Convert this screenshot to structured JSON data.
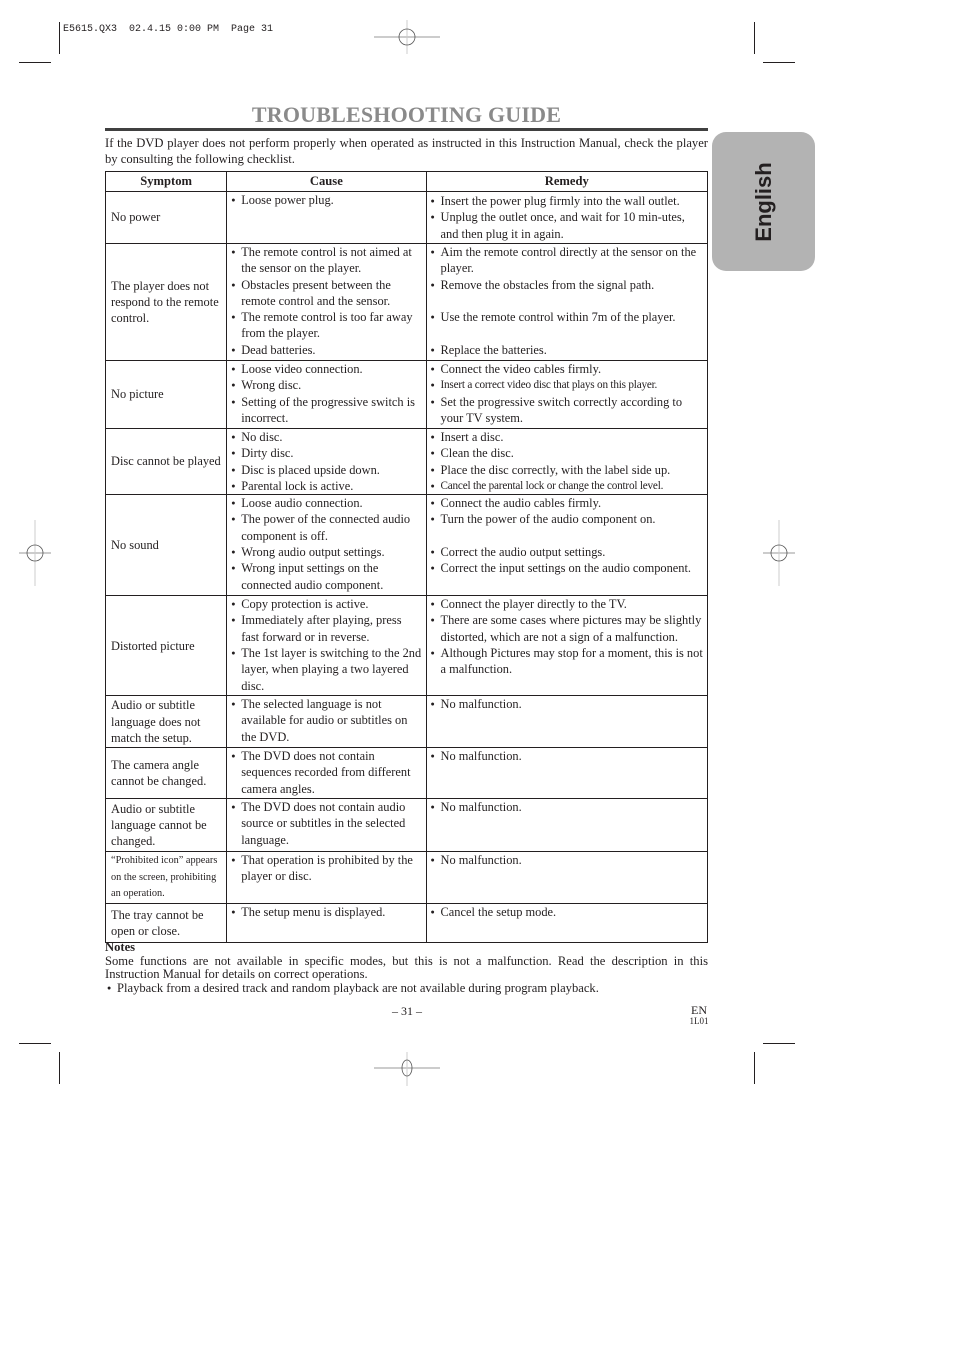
{
  "slug": "E5615.QX3  02.4.15 0:00 PM  Page 31",
  "title": "TROUBLESHOOTING GUIDE",
  "intro": "If the DVD player does not perform properly when operated as instructed in this Instruction Manual, check the player by consulting the following checklist.",
  "side_tab": "English",
  "table": {
    "headers": [
      "Symptom",
      "Cause",
      "Remedy"
    ],
    "rows": [
      {
        "symptom": "No power",
        "causes": [
          "Loose power plug."
        ],
        "remedies": [
          "Insert the power plug firmly into the wall outlet.",
          "Unplug the outlet once, and wait for 10 min-utes, and then plug it in again."
        ]
      },
      {
        "symptom": "The player does not respond to the remote control.",
        "causes": [
          "The remote control is not aimed at the sensor on the player.",
          "Obstacles present between the remote control and the sensor.",
          "The remote control is too far away from the player.",
          "Dead batteries."
        ],
        "remedies": [
          "Aim the remote control directly at the sensor on the player.",
          "Remove the obstacles from the signal path.",
          "Use the remote control within 7m of the player.",
          "Replace the batteries."
        ]
      },
      {
        "symptom": "No picture",
        "causes": [
          "Loose video connection.",
          "Wrong disc.",
          "Setting of the progressive switch is incorrect."
        ],
        "remedies": [
          "Connect the video cables firmly.",
          "Insert a correct video disc that plays on this player.",
          "Set the progressive switch correctly according to your TV system."
        ]
      },
      {
        "symptom": "Disc cannot be played",
        "causes": [
          "No disc.",
          "Dirty disc.",
          "Disc is placed upside down.",
          "Parental lock is active."
        ],
        "remedies": [
          "Insert a disc.",
          "Clean the disc.",
          "Place the disc correctly, with the label side up.",
          "Cancel the parental lock or change the control level."
        ]
      },
      {
        "symptom": "No sound",
        "causes": [
          "Loose audio connection.",
          "The power of the connected audio component is off.",
          "Wrong audio output settings.",
          "Wrong input settings on the connected audio component."
        ],
        "remedies": [
          "Connect the audio cables firmly.",
          "Turn the power of the audio component on.",
          "Correct the audio output settings.",
          "Correct the input settings on the audio component."
        ]
      },
      {
        "symptom": "Distorted picture",
        "causes": [
          "Copy protection is active.",
          "Immediately after playing, press fast forward or in reverse.",
          "The 1st layer is switching to the 2nd layer, when playing a two layered disc."
        ],
        "remedies": [
          "Connect the player directly to the TV.",
          "There are some cases where pictures may be slightly distorted, which are not a sign of a malfunction.",
          "Although Pictures may stop for a moment, this is not a malfunction."
        ]
      },
      {
        "symptom": "Audio or subtitle language does not match the setup.",
        "causes": [
          "The selected language is not available for audio or subtitles on the DVD."
        ],
        "remedies": [
          "No malfunction."
        ]
      },
      {
        "symptom": "The camera angle cannot be changed.",
        "causes": [
          "The DVD does not contain sequences recorded from different camera angles."
        ],
        "remedies": [
          "No malfunction."
        ]
      },
      {
        "symptom": "Audio or subtitle language cannot be changed.",
        "causes": [
          "The DVD does not contain audio source or subtitles in the selected language."
        ],
        "remedies": [
          "No malfunction."
        ]
      },
      {
        "symptom": "“Prohibited icon” appears on the screen, prohibiting an operation.",
        "causes": [
          "That operation is prohibited by the player or disc."
        ],
        "remedies": [
          "No malfunction."
        ]
      },
      {
        "symptom": "The tray cannot be open or close.",
        "causes": [
          "The setup menu is displayed."
        ],
        "remedies": [
          "Cancel the setup mode."
        ]
      }
    ]
  },
  "notes": {
    "heading": "Notes",
    "text": "Some functions are not available in specific modes, but this is not a malfunction. Read the description in this Instruction Manual for details on correct operations.",
    "bullet": "Playback from a desired track and random playback are not available during program playback."
  },
  "footer": {
    "page_number": "– 31 –",
    "lang_code": "EN",
    "doc_code": "1L01"
  }
}
